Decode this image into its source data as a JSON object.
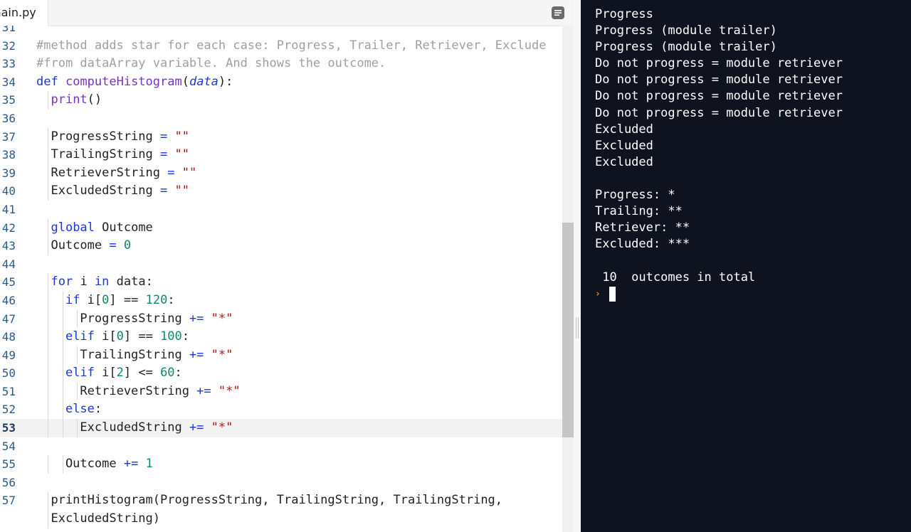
{
  "editor": {
    "tab_label": "main.py",
    "lines": [
      {
        "n": "31",
        "tokens": []
      },
      {
        "n": "32",
        "tokens": [
          {
            "c": "t-com",
            "t": "#method adds star for each case: Progress, Trailer, Retriever, Exclude"
          }
        ]
      },
      {
        "n": "33",
        "tokens": [
          {
            "c": "t-com",
            "t": "#from dataArray variable. And shows the outcome."
          }
        ]
      },
      {
        "n": "34",
        "tokens": [
          {
            "c": "t-kw",
            "t": "def "
          },
          {
            "c": "t-fn",
            "t": "computeHistogram"
          },
          {
            "c": "",
            "t": "("
          },
          {
            "c": "t-arg",
            "t": "data"
          },
          {
            "c": "",
            "t": "):"
          }
        ]
      },
      {
        "n": "35",
        "tokens": [
          {
            "c": "",
            "t": "  "
          },
          {
            "c": "t-fn",
            "t": "print"
          },
          {
            "c": "",
            "t": "()"
          }
        ]
      },
      {
        "n": "36",
        "tokens": []
      },
      {
        "n": "37",
        "tokens": [
          {
            "c": "",
            "t": "  ProgressString "
          },
          {
            "c": "t-op",
            "t": "="
          },
          {
            "c": "",
            "t": " "
          },
          {
            "c": "t-str",
            "t": "\"\""
          }
        ]
      },
      {
        "n": "38",
        "tokens": [
          {
            "c": "",
            "t": "  TrailingString "
          },
          {
            "c": "t-op",
            "t": "="
          },
          {
            "c": "",
            "t": " "
          },
          {
            "c": "t-str",
            "t": "\"\""
          }
        ]
      },
      {
        "n": "39",
        "tokens": [
          {
            "c": "",
            "t": "  RetrieverString "
          },
          {
            "c": "t-op",
            "t": "="
          },
          {
            "c": "",
            "t": " "
          },
          {
            "c": "t-str",
            "t": "\"\""
          }
        ]
      },
      {
        "n": "40",
        "tokens": [
          {
            "c": "",
            "t": "  ExcludedString "
          },
          {
            "c": "t-op",
            "t": "="
          },
          {
            "c": "",
            "t": " "
          },
          {
            "c": "t-str",
            "t": "\"\""
          }
        ]
      },
      {
        "n": "41",
        "tokens": []
      },
      {
        "n": "42",
        "tokens": [
          {
            "c": "",
            "t": "  "
          },
          {
            "c": "t-kw",
            "t": "global"
          },
          {
            "c": "",
            "t": " Outcome"
          }
        ]
      },
      {
        "n": "43",
        "tokens": [
          {
            "c": "",
            "t": "  Outcome "
          },
          {
            "c": "t-op",
            "t": "="
          },
          {
            "c": "",
            "t": " "
          },
          {
            "c": "t-num",
            "t": "0"
          }
        ]
      },
      {
        "n": "44",
        "tokens": []
      },
      {
        "n": "45",
        "tokens": [
          {
            "c": "",
            "t": "  "
          },
          {
            "c": "t-kw",
            "t": "for"
          },
          {
            "c": "",
            "t": " i "
          },
          {
            "c": "t-kw",
            "t": "in"
          },
          {
            "c": "",
            "t": " data:"
          }
        ]
      },
      {
        "n": "46",
        "tokens": [
          {
            "c": "",
            "t": "    "
          },
          {
            "c": "t-kw",
            "t": "if"
          },
          {
            "c": "",
            "t": " i["
          },
          {
            "c": "t-num",
            "t": "0"
          },
          {
            "c": "",
            "t": "] == "
          },
          {
            "c": "t-num",
            "t": "120"
          },
          {
            "c": "",
            "t": ":"
          }
        ]
      },
      {
        "n": "47",
        "tokens": [
          {
            "c": "",
            "t": "      ProgressString "
          },
          {
            "c": "t-op",
            "t": "+="
          },
          {
            "c": "",
            "t": " "
          },
          {
            "c": "t-str",
            "t": "\"*\""
          }
        ]
      },
      {
        "n": "48",
        "tokens": [
          {
            "c": "",
            "t": "    "
          },
          {
            "c": "t-kw",
            "t": "elif"
          },
          {
            "c": "",
            "t": " i["
          },
          {
            "c": "t-num",
            "t": "0"
          },
          {
            "c": "",
            "t": "] == "
          },
          {
            "c": "t-num",
            "t": "100"
          },
          {
            "c": "",
            "t": ":"
          }
        ]
      },
      {
        "n": "49",
        "tokens": [
          {
            "c": "",
            "t": "      TrailingString "
          },
          {
            "c": "t-op",
            "t": "+="
          },
          {
            "c": "",
            "t": " "
          },
          {
            "c": "t-str",
            "t": "\"*\""
          }
        ]
      },
      {
        "n": "50",
        "tokens": [
          {
            "c": "",
            "t": "    "
          },
          {
            "c": "t-kw",
            "t": "elif"
          },
          {
            "c": "",
            "t": " i["
          },
          {
            "c": "t-num",
            "t": "2"
          },
          {
            "c": "",
            "t": "] <= "
          },
          {
            "c": "t-num",
            "t": "60"
          },
          {
            "c": "",
            "t": ":"
          }
        ]
      },
      {
        "n": "51",
        "tokens": [
          {
            "c": "",
            "t": "      RetrieverString "
          },
          {
            "c": "t-op",
            "t": "+="
          },
          {
            "c": "",
            "t": " "
          },
          {
            "c": "t-str",
            "t": "\"*\""
          }
        ]
      },
      {
        "n": "52",
        "tokens": [
          {
            "c": "",
            "t": "    "
          },
          {
            "c": "t-kw",
            "t": "else"
          },
          {
            "c": "",
            "t": ":"
          }
        ]
      },
      {
        "n": "53",
        "active": true,
        "tokens": [
          {
            "c": "",
            "t": "      ExcludedString "
          },
          {
            "c": "t-op",
            "t": "+="
          },
          {
            "c": "",
            "t": " "
          },
          {
            "c": "t-str",
            "t": "\"*\""
          }
        ]
      },
      {
        "n": "54",
        "tokens": []
      },
      {
        "n": "55",
        "tokens": [
          {
            "c": "",
            "t": "    Outcome "
          },
          {
            "c": "t-op",
            "t": "+="
          },
          {
            "c": "",
            "t": " "
          },
          {
            "c": "t-num",
            "t": "1"
          }
        ]
      },
      {
        "n": "56",
        "tokens": []
      },
      {
        "n": "57",
        "tokens": [
          {
            "c": "",
            "t": "  printHistogram(ProgressString, TrailingString, TrailingString,"
          }
        ]
      },
      {
        "n": "",
        "tokens": [
          {
            "c": "",
            "t": "  ExcludedString)"
          }
        ]
      }
    ]
  },
  "console": {
    "lines": [
      "Progress",
      "Progress (module trailer)",
      "Progress (module trailer)",
      "Do not progress = module retriever",
      "Do not progress = module retriever",
      "Do not progress = module retriever",
      "Do not progress = module retriever",
      "Excluded",
      "Excluded",
      "Excluded",
      "",
      "Progress: *",
      "Trailing: **",
      "Retriever: **",
      "Excluded: ***",
      "",
      " 10  outcomes in total"
    ],
    "prompt_icon": "prompt-arrow-icon"
  }
}
